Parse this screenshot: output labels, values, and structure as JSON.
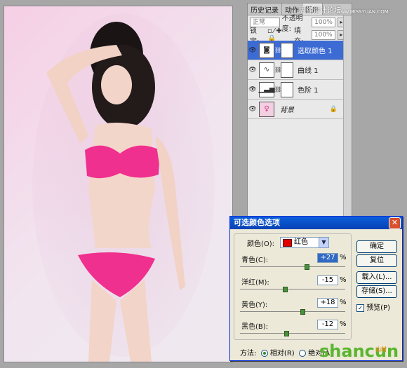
{
  "panel": {
    "tabs": [
      "历史记录",
      "动作",
      "图层"
    ],
    "watermark": "思缘设计论坛",
    "watermark_url": "www.MISSYUAN.COM",
    "blend_mode": "正常",
    "opacity_label": "不透明度:",
    "opacity_value": "100%",
    "lock_label": "锁定:",
    "fill_label": "填充:",
    "fill_value": "100%",
    "layers": [
      {
        "name": "选取颜色 1",
        "icon": "selective-color-icon",
        "active": true
      },
      {
        "name": "曲线 1",
        "icon": "curves-icon",
        "active": false
      },
      {
        "name": "色阶 1",
        "icon": "levels-icon",
        "active": false
      },
      {
        "name": "背景",
        "icon": "photo-thumbnail",
        "active": false
      }
    ]
  },
  "dialog": {
    "title": "可选颜色选项",
    "color_label": "颜色(O):",
    "color_value": "红色",
    "color_swatch": "#e00000",
    "sliders": [
      {
        "label": "青色(C):",
        "value": "+27",
        "level": 0.635
      },
      {
        "label": "洋红(M):",
        "value": "-15",
        "level": 0.425
      },
      {
        "label": "黄色(Y):",
        "value": "+18",
        "level": 0.59
      },
      {
        "label": "黑色(B):",
        "value": "-12",
        "level": 0.44
      }
    ],
    "percent": "%",
    "buttons": {
      "ok": "确定",
      "reset": "复位",
      "load": "载入(L)...",
      "save": "存储(S)..."
    },
    "preview_label": "预览(P)",
    "method_label": "方法:",
    "method_relative": "相对(R)",
    "method_absolute": "绝对(A)"
  },
  "logo": {
    "main": "shancun",
    "sub": "山村"
  }
}
